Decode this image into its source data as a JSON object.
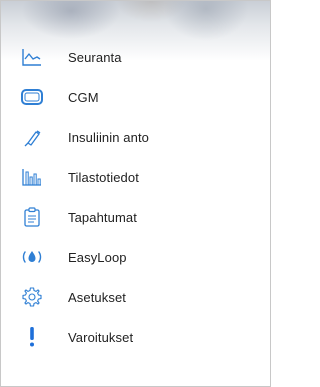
{
  "menu": {
    "items": [
      {
        "label": "Seuranta",
        "icon": "line-chart-icon"
      },
      {
        "label": "CGM",
        "icon": "sensor-device-icon"
      },
      {
        "label": "Insuliinin anto",
        "icon": "syringe-icon"
      },
      {
        "label": "Tilastotiedot",
        "icon": "bar-chart-icon"
      },
      {
        "label": "Tapahtumat",
        "icon": "clipboard-icon"
      },
      {
        "label": "EasyLoop",
        "icon": "drop-loop-icon"
      },
      {
        "label": "Asetukset",
        "icon": "gear-icon"
      },
      {
        "label": "Varoitukset",
        "icon": "exclamation-icon"
      }
    ]
  },
  "colors": {
    "icon_blue": "#2f7fd4",
    "warning_blue": "#1e6fd9",
    "text": "#222222"
  }
}
